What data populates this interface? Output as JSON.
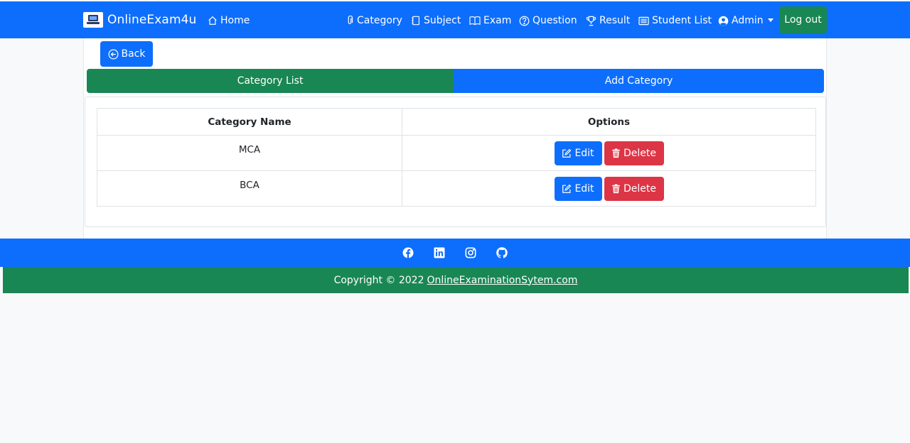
{
  "navbar": {
    "brand": "OnlineExam4u",
    "home": "Home",
    "links": [
      {
        "label": "Category",
        "icon": "paperclip-icon"
      },
      {
        "label": "Subject",
        "icon": "notebook-icon"
      },
      {
        "label": "Exam",
        "icon": "book-icon"
      },
      {
        "label": "Question",
        "icon": "question-circle-icon"
      },
      {
        "label": "Result",
        "icon": "trophy-icon"
      },
      {
        "label": "Student List",
        "icon": "list-icon"
      }
    ],
    "admin": "Admin",
    "logout": "Log out"
  },
  "back_label": "Back",
  "tabs": {
    "list": "Category List",
    "add": "Add Category"
  },
  "table": {
    "headers": [
      "Category Name",
      "Options"
    ],
    "rows": [
      {
        "name": "MCA"
      },
      {
        "name": "BCA"
      }
    ],
    "edit_label": "Edit",
    "delete_label": "Delete"
  },
  "footer": {
    "social": [
      "facebook-icon",
      "linkedin-icon",
      "instagram-icon",
      "github-icon"
    ],
    "copyright": "Copyright © 2022",
    "link": "OnlineExaminationSytem.com"
  },
  "colors": {
    "primary": "#0d6efd",
    "success": "#198754",
    "danger": "#dc3545"
  }
}
